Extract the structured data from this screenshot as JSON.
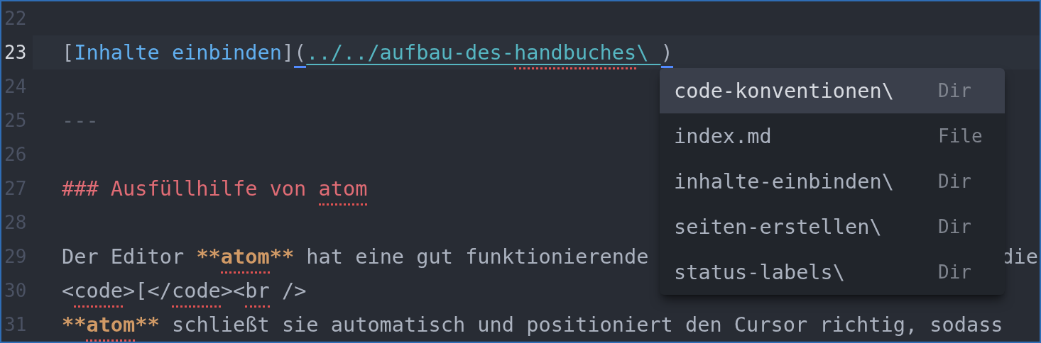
{
  "editor": {
    "lines": [
      {
        "number": "22",
        "current": false
      },
      {
        "number": "23",
        "current": true,
        "tokens": [
          {
            "kind": "punct",
            "text": "["
          },
          {
            "kind": "link_text",
            "text": "Inhalte einbinden"
          },
          {
            "kind": "punct",
            "text": "]"
          },
          {
            "kind": "punct",
            "text": "(",
            "matched": true
          },
          {
            "kind": "url",
            "text": "../../aufbau-des-"
          },
          {
            "kind": "url",
            "text": "handbuches",
            "misspelled": true
          },
          {
            "kind": "url",
            "text": "\\ "
          },
          {
            "kind": "punct",
            "text": ")",
            "matched": true
          }
        ]
      },
      {
        "number": "24",
        "current": false
      },
      {
        "number": "25",
        "current": false,
        "tokens": [
          {
            "kind": "rule",
            "text": "---"
          }
        ]
      },
      {
        "number": "26",
        "current": false
      },
      {
        "number": "27",
        "current": false,
        "tokens": [
          {
            "kind": "heading",
            "text": "### Ausfüllhilfe von "
          },
          {
            "kind": "heading",
            "text": "atom",
            "misspelled": true
          }
        ]
      },
      {
        "number": "28",
        "current": false
      },
      {
        "number": "29",
        "current": false,
        "tokens": [
          {
            "kind": "text",
            "text": "Der Editor "
          },
          {
            "kind": "bold",
            "text": "**"
          },
          {
            "kind": "bold",
            "text": "atom",
            "misspelled": true
          },
          {
            "kind": "bold",
            "text": "**"
          },
          {
            "kind": "text",
            "text": " hat eine gut funktionierende"
          }
        ],
        "tail": "die"
      },
      {
        "number": "30",
        "current": false,
        "tokens": [
          {
            "kind": "text",
            "text": "<"
          },
          {
            "kind": "text",
            "text": "code",
            "misspelled": true
          },
          {
            "kind": "text",
            "text": ">[</"
          },
          {
            "kind": "text",
            "text": "code",
            "misspelled": true
          },
          {
            "kind": "text",
            "text": "><"
          },
          {
            "kind": "text",
            "text": "br",
            "misspelled": true
          },
          {
            "kind": "text",
            "text": " />"
          }
        ]
      },
      {
        "number": "31",
        "current": false,
        "tokens": [
          {
            "kind": "bold",
            "text": "**"
          },
          {
            "kind": "bold",
            "text": "atom",
            "misspelled": true
          },
          {
            "kind": "bold",
            "text": "**"
          },
          {
            "kind": "text",
            "text": " schließt sie automatisch und positioniert den Cursor richtig, sodass"
          }
        ]
      }
    ]
  },
  "autocomplete": {
    "items": [
      {
        "label": "code-konventionen\\",
        "type": "Dir",
        "selected": true
      },
      {
        "label": "index.md",
        "type": "File",
        "selected": false
      },
      {
        "label": "inhalte-einbinden\\",
        "type": "Dir",
        "selected": false
      },
      {
        "label": "seiten-erstellen\\",
        "type": "Dir",
        "selected": false
      },
      {
        "label": "status-labels\\",
        "type": "Dir",
        "selected": false
      }
    ]
  }
}
